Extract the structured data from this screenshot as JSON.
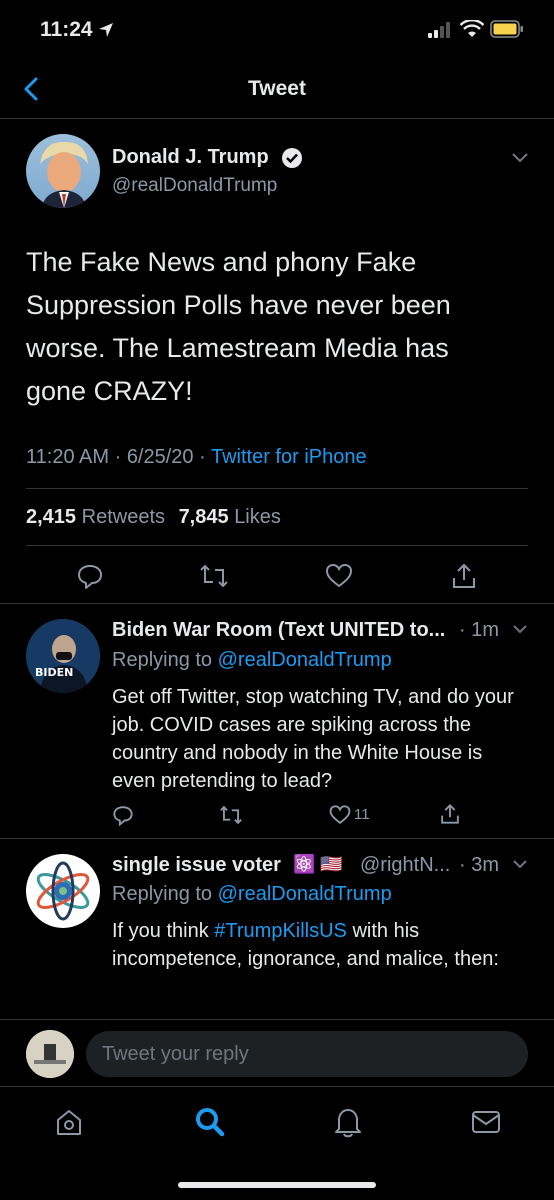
{
  "status_bar": {
    "time": "11:24"
  },
  "header": {
    "title": "Tweet"
  },
  "main_tweet": {
    "author_name": "Donald J. Trump",
    "handle": "@realDonaldTrump",
    "text": "The Fake News and phony Fake Suppression Polls have never been worse. The Lamestream Media has gone CRAZY!",
    "time": "11:20 AM",
    "date": "6/25/20",
    "source": "Twitter for iPhone",
    "retweets_count": "2,415",
    "retweets_label": "Retweets",
    "likes_count": "7,845",
    "likes_label": "Likes"
  },
  "replies": [
    {
      "author_name": "Biden War Room (Text UNITED to...",
      "time": "1m",
      "replying_label": "Replying to",
      "replying_handle": "@realDonaldTrump",
      "text": "Get off Twitter, stop watching TV, and do your job. COVID cases are spiking across the country and nobody in the White House is even pretending to lead?",
      "like_count": "11",
      "avatar_text": "BIDEN"
    },
    {
      "author_name": "single issue voter",
      "emoji": "⚛️ 🇺🇸",
      "handle": "@rightN...",
      "time": "3m",
      "replying_label": "Replying to",
      "replying_handle": "@realDonaldTrump",
      "text_before": "If you think ",
      "hashtag": "#TrumpKillsUS",
      "text_after": " with his incompetence, ignorance, and malice, then:"
    }
  ],
  "reply_bar": {
    "placeholder": "Tweet your reply"
  },
  "colors": {
    "accent": "#1d9bf0",
    "background": "#000000",
    "muted": "#8b98a5",
    "divider": "#2f3336",
    "battery": "#f6d34a"
  }
}
